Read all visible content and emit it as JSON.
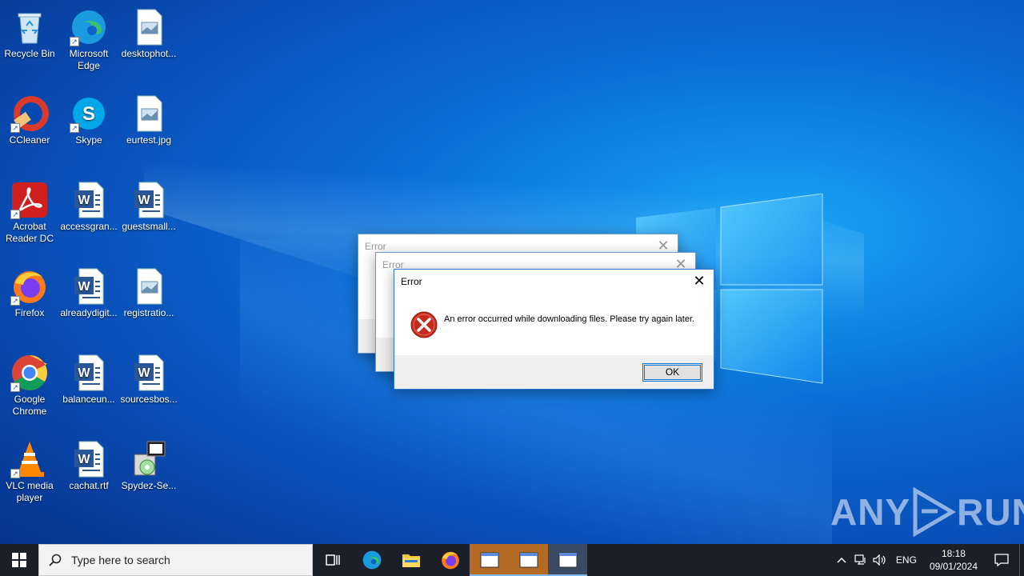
{
  "desktop": {
    "icons": [
      {
        "label": "Recycle Bin",
        "icon": "recycle-bin-icon"
      },
      {
        "label": "Microsoft Edge",
        "icon": "edge-icon"
      },
      {
        "label": "desktophot...",
        "icon": "image-file-icon"
      },
      {
        "label": "CCleaner",
        "icon": "ccleaner-icon"
      },
      {
        "label": "Skype",
        "icon": "skype-icon"
      },
      {
        "label": "eurtest.jpg",
        "icon": "image-file-icon"
      },
      {
        "label": "Acrobat Reader DC",
        "icon": "acrobat-icon"
      },
      {
        "label": "accessgran...",
        "icon": "word-doc-icon"
      },
      {
        "label": "guestsmall...",
        "icon": "word-doc-icon"
      },
      {
        "label": "Firefox",
        "icon": "firefox-icon"
      },
      {
        "label": "alreadydigit...",
        "icon": "word-doc-icon"
      },
      {
        "label": "registratio...",
        "icon": "image-file-icon"
      },
      {
        "label": "Google Chrome",
        "icon": "chrome-icon"
      },
      {
        "label": "balanceun...",
        "icon": "word-doc-icon"
      },
      {
        "label": "sourcesbos...",
        "icon": "word-doc-icon"
      },
      {
        "label": "VLC media player",
        "icon": "vlc-icon"
      },
      {
        "label": "cachat.rtf",
        "icon": "word-doc-icon"
      },
      {
        "label": "Spydez-Se...",
        "icon": "installer-icon"
      }
    ]
  },
  "dialogs": [
    {
      "title": "Error"
    },
    {
      "title": "Error"
    },
    {
      "title": "Error",
      "message": "An error occurred while downloading files. Please try again later.",
      "ok_label": "OK"
    }
  ],
  "watermark": {
    "text_left": "ANY",
    "text_right": "RUN"
  },
  "taskbar": {
    "search_placeholder": "Type here to search",
    "lang": "ENG",
    "time": "18:18",
    "date": "09/01/2024"
  },
  "colors": {
    "accent": "#0078d7",
    "error_red": "#c42b1c",
    "taskbar": "#1b1f2a"
  }
}
